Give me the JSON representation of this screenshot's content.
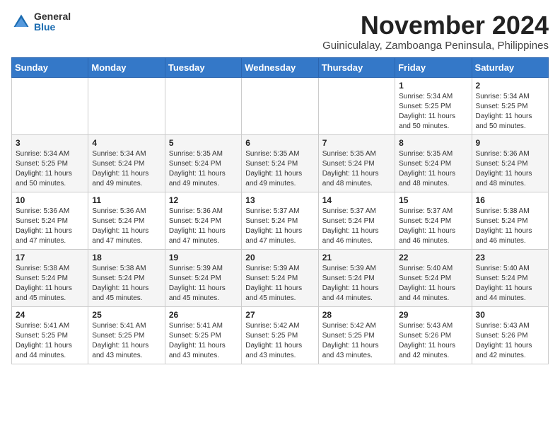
{
  "logo": {
    "general": "General",
    "blue": "Blue"
  },
  "title": "November 2024",
  "subtitle": "Guiniculalay, Zamboanga Peninsula, Philippines",
  "days_of_week": [
    "Sunday",
    "Monday",
    "Tuesday",
    "Wednesday",
    "Thursday",
    "Friday",
    "Saturday"
  ],
  "weeks": [
    [
      {
        "day": "",
        "info": ""
      },
      {
        "day": "",
        "info": ""
      },
      {
        "day": "",
        "info": ""
      },
      {
        "day": "",
        "info": ""
      },
      {
        "day": "",
        "info": ""
      },
      {
        "day": "1",
        "info": "Sunrise: 5:34 AM\nSunset: 5:25 PM\nDaylight: 11 hours\nand 50 minutes."
      },
      {
        "day": "2",
        "info": "Sunrise: 5:34 AM\nSunset: 5:25 PM\nDaylight: 11 hours\nand 50 minutes."
      }
    ],
    [
      {
        "day": "3",
        "info": "Sunrise: 5:34 AM\nSunset: 5:25 PM\nDaylight: 11 hours\nand 50 minutes."
      },
      {
        "day": "4",
        "info": "Sunrise: 5:34 AM\nSunset: 5:24 PM\nDaylight: 11 hours\nand 49 minutes."
      },
      {
        "day": "5",
        "info": "Sunrise: 5:35 AM\nSunset: 5:24 PM\nDaylight: 11 hours\nand 49 minutes."
      },
      {
        "day": "6",
        "info": "Sunrise: 5:35 AM\nSunset: 5:24 PM\nDaylight: 11 hours\nand 49 minutes."
      },
      {
        "day": "7",
        "info": "Sunrise: 5:35 AM\nSunset: 5:24 PM\nDaylight: 11 hours\nand 48 minutes."
      },
      {
        "day": "8",
        "info": "Sunrise: 5:35 AM\nSunset: 5:24 PM\nDaylight: 11 hours\nand 48 minutes."
      },
      {
        "day": "9",
        "info": "Sunrise: 5:36 AM\nSunset: 5:24 PM\nDaylight: 11 hours\nand 48 minutes."
      }
    ],
    [
      {
        "day": "10",
        "info": "Sunrise: 5:36 AM\nSunset: 5:24 PM\nDaylight: 11 hours\nand 47 minutes."
      },
      {
        "day": "11",
        "info": "Sunrise: 5:36 AM\nSunset: 5:24 PM\nDaylight: 11 hours\nand 47 minutes."
      },
      {
        "day": "12",
        "info": "Sunrise: 5:36 AM\nSunset: 5:24 PM\nDaylight: 11 hours\nand 47 minutes."
      },
      {
        "day": "13",
        "info": "Sunrise: 5:37 AM\nSunset: 5:24 PM\nDaylight: 11 hours\nand 47 minutes."
      },
      {
        "day": "14",
        "info": "Sunrise: 5:37 AM\nSunset: 5:24 PM\nDaylight: 11 hours\nand 46 minutes."
      },
      {
        "day": "15",
        "info": "Sunrise: 5:37 AM\nSunset: 5:24 PM\nDaylight: 11 hours\nand 46 minutes."
      },
      {
        "day": "16",
        "info": "Sunrise: 5:38 AM\nSunset: 5:24 PM\nDaylight: 11 hours\nand 46 minutes."
      }
    ],
    [
      {
        "day": "17",
        "info": "Sunrise: 5:38 AM\nSunset: 5:24 PM\nDaylight: 11 hours\nand 45 minutes."
      },
      {
        "day": "18",
        "info": "Sunrise: 5:38 AM\nSunset: 5:24 PM\nDaylight: 11 hours\nand 45 minutes."
      },
      {
        "day": "19",
        "info": "Sunrise: 5:39 AM\nSunset: 5:24 PM\nDaylight: 11 hours\nand 45 minutes."
      },
      {
        "day": "20",
        "info": "Sunrise: 5:39 AM\nSunset: 5:24 PM\nDaylight: 11 hours\nand 45 minutes."
      },
      {
        "day": "21",
        "info": "Sunrise: 5:39 AM\nSunset: 5:24 PM\nDaylight: 11 hours\nand 44 minutes."
      },
      {
        "day": "22",
        "info": "Sunrise: 5:40 AM\nSunset: 5:24 PM\nDaylight: 11 hours\nand 44 minutes."
      },
      {
        "day": "23",
        "info": "Sunrise: 5:40 AM\nSunset: 5:24 PM\nDaylight: 11 hours\nand 44 minutes."
      }
    ],
    [
      {
        "day": "24",
        "info": "Sunrise: 5:41 AM\nSunset: 5:25 PM\nDaylight: 11 hours\nand 44 minutes."
      },
      {
        "day": "25",
        "info": "Sunrise: 5:41 AM\nSunset: 5:25 PM\nDaylight: 11 hours\nand 43 minutes."
      },
      {
        "day": "26",
        "info": "Sunrise: 5:41 AM\nSunset: 5:25 PM\nDaylight: 11 hours\nand 43 minutes."
      },
      {
        "day": "27",
        "info": "Sunrise: 5:42 AM\nSunset: 5:25 PM\nDaylight: 11 hours\nand 43 minutes."
      },
      {
        "day": "28",
        "info": "Sunrise: 5:42 AM\nSunset: 5:25 PM\nDaylight: 11 hours\nand 43 minutes."
      },
      {
        "day": "29",
        "info": "Sunrise: 5:43 AM\nSunset: 5:26 PM\nDaylight: 11 hours\nand 42 minutes."
      },
      {
        "day": "30",
        "info": "Sunrise: 5:43 AM\nSunset: 5:26 PM\nDaylight: 11 hours\nand 42 minutes."
      }
    ]
  ]
}
